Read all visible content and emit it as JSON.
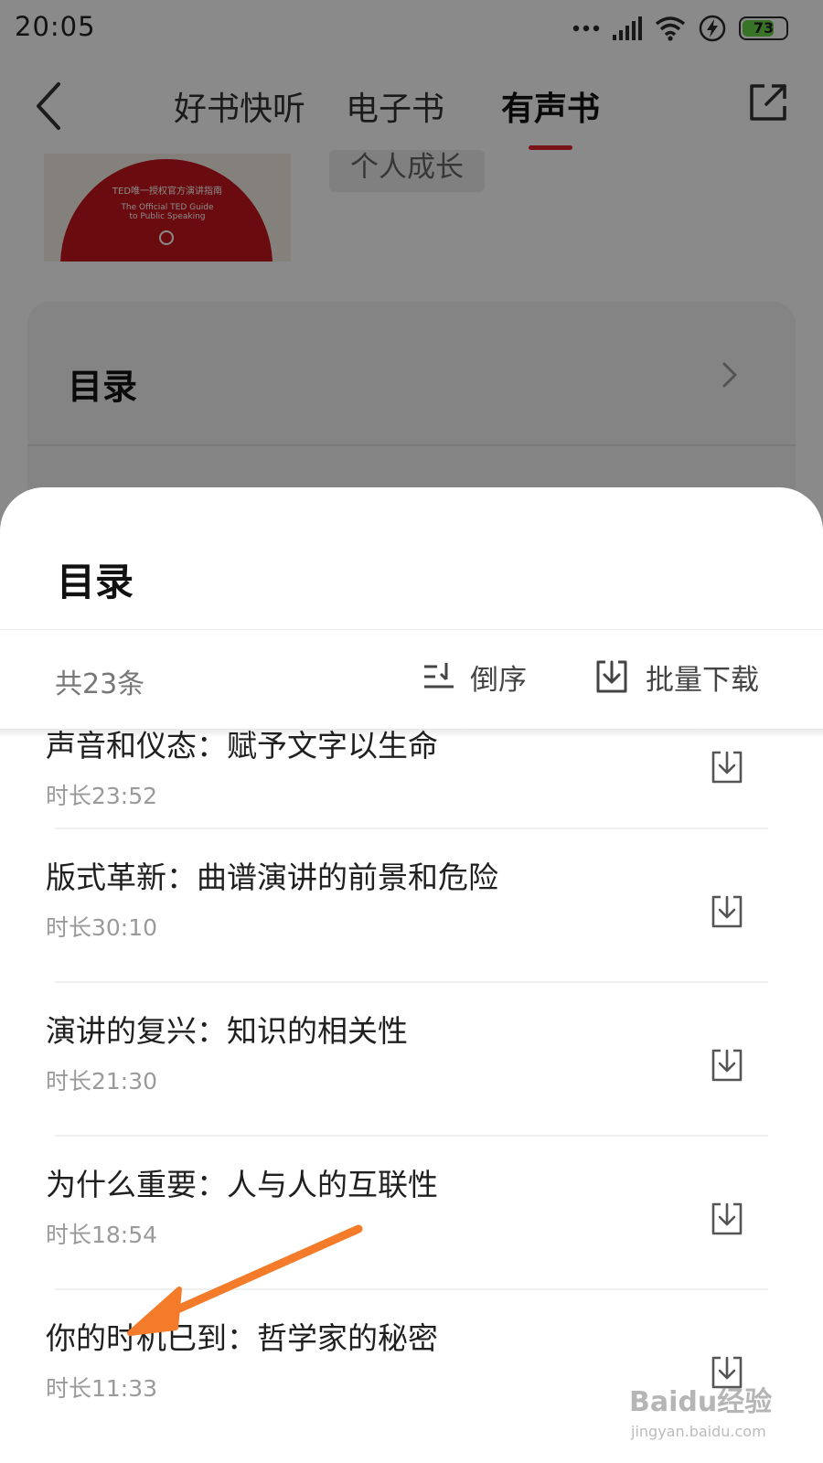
{
  "status_bar": {
    "time": "20:05",
    "battery_level": "73",
    "battery_fraction": 0.73,
    "icons": [
      "more-dots-icon",
      "signal-icon",
      "wifi-icon",
      "charging-icon",
      "battery-icon"
    ]
  },
  "nav": {
    "tabs": [
      {
        "label": "好书快听",
        "active": false
      },
      {
        "label": "电子书",
        "active": false
      },
      {
        "label": "有声书",
        "active": true
      }
    ],
    "accent_color": "#e0242b"
  },
  "background": {
    "book_cover_lines": [
      "TED唯一授权官方演讲指南",
      "The Official TED Guide",
      "to Public Speaking"
    ],
    "tag": "个人成长",
    "catalog_card_title": "目录"
  },
  "sheet": {
    "title": "目录",
    "item_count": "共23条",
    "sort_label": "倒序",
    "batch_download_label": "批量下载"
  },
  "chapters": [
    {
      "title": "声音和仪态：赋予文字以生命",
      "duration": "时长23:52"
    },
    {
      "title": "版式革新：曲谱演讲的前景和危险",
      "duration": "时长30:10"
    },
    {
      "title": "演讲的复兴：知识的相关性",
      "duration": "时长21:30"
    },
    {
      "title": "为什么重要：人与人的互联性",
      "duration": "时长18:54"
    },
    {
      "title": "你的时机已到：哲学家的秘密",
      "duration": "时长11:33"
    }
  ],
  "watermark": {
    "brand": "Baidu经验",
    "url": "jingyan.baidu.com"
  },
  "annotation_color": "#f47b2a"
}
